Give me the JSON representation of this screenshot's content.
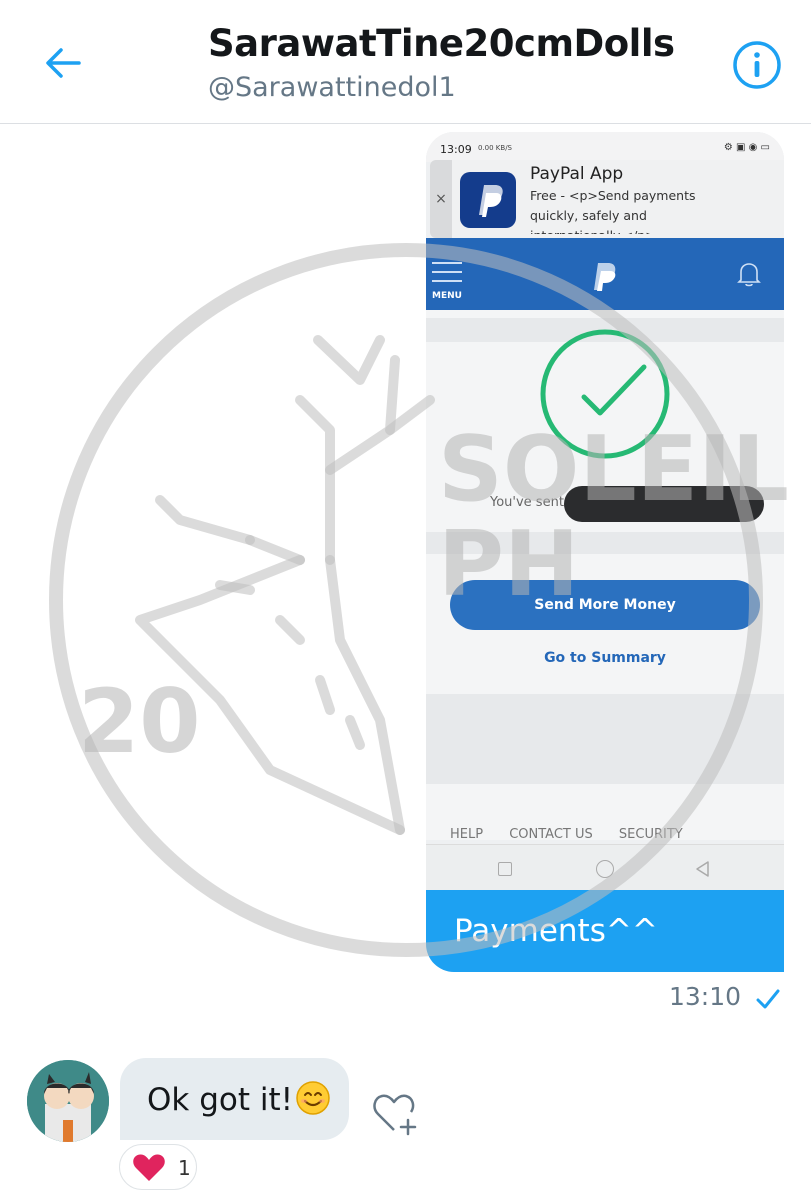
{
  "header": {
    "title": "SarawatTine20cmDolls",
    "handle": "@Sarawattinedol1",
    "accent_color": "#1da1f2"
  },
  "sent_message": {
    "screenshot": {
      "status_time": "13:09",
      "status_signal": "0.00 KB/S",
      "banner": {
        "title": "PayPal App",
        "description": "Free - <p>Send payments quickly, safely and internationally.</p>"
      },
      "menu_label": "MENU",
      "sent_text": "You've sent",
      "send_more_label": "Send More Money",
      "summary_label": "Go to Summary",
      "footer_links": [
        "HELP",
        "CONTACT US",
        "SECURITY"
      ]
    },
    "caption": "Payments^^",
    "timestamp": "13:10"
  },
  "watermark": {
    "word1": "SOLEIL",
    "word2": "PH",
    "number": "20"
  },
  "received_message": {
    "text": "Ok got it!",
    "reaction_count": "1"
  }
}
